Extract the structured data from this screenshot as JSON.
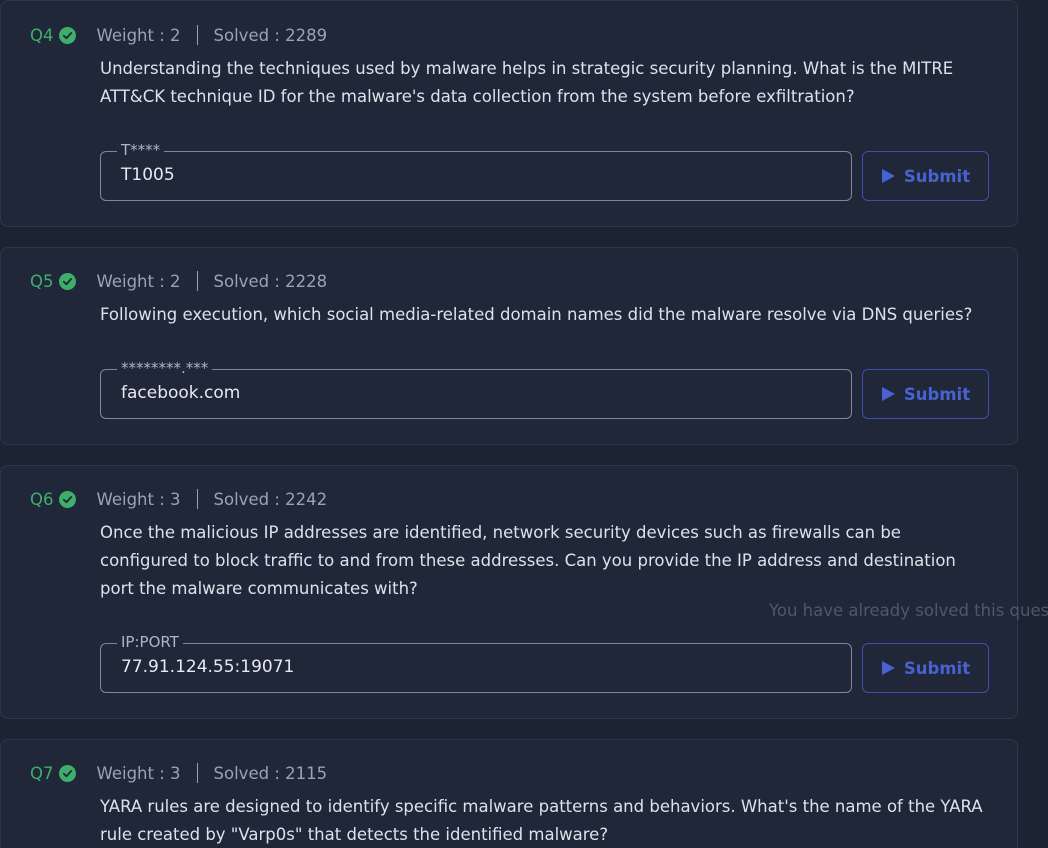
{
  "questions": [
    {
      "number": "Q4",
      "weight": "Weight : 2",
      "solved": "Solved : 2289",
      "text": "Understanding the techniques used by malware helps in strategic security planning. What is the MITRE ATT&CK technique ID for the malware's data collection from the system before exfiltration?",
      "answer_format": "T****",
      "answer_value": "T1005",
      "submit_label": "Submit"
    },
    {
      "number": "Q5",
      "weight": "Weight : 2",
      "solved": "Solved : 2228",
      "text": "Following execution, which social media-related domain names did the malware resolve via DNS queries?",
      "answer_format": "********.***",
      "answer_value": "facebook.com",
      "submit_label": "Submit"
    },
    {
      "number": "Q6",
      "weight": "Weight : 3",
      "solved": "Solved : 2242",
      "text": "Once the malicious IP addresses are identified, network security devices such as firewalls can be configured to block traffic to and from these addresses. Can you provide the IP address and destination port the malware communicates with?",
      "answer_format": "IP:PORT",
      "answer_value": "77.91.124.55:19071",
      "submit_label": "Submit"
    },
    {
      "number": "Q7",
      "weight": "Weight : 3",
      "solved": "Solved : 2115",
      "text": "YARA rules are designed to identify specific malware patterns and behaviors. What's the name of the YARA rule created by \"Varp0s\" that detects the identified malware?"
    }
  ],
  "tooltip_text": "You have already solved this ques",
  "colors": {
    "solved_green": "#3fae6b",
    "accent_blue": "#4a62cf",
    "card_bg": "#1f2738",
    "page_bg": "#1c2434"
  },
  "icons": {
    "solved": "check-circle-icon",
    "submit": "play-icon"
  }
}
